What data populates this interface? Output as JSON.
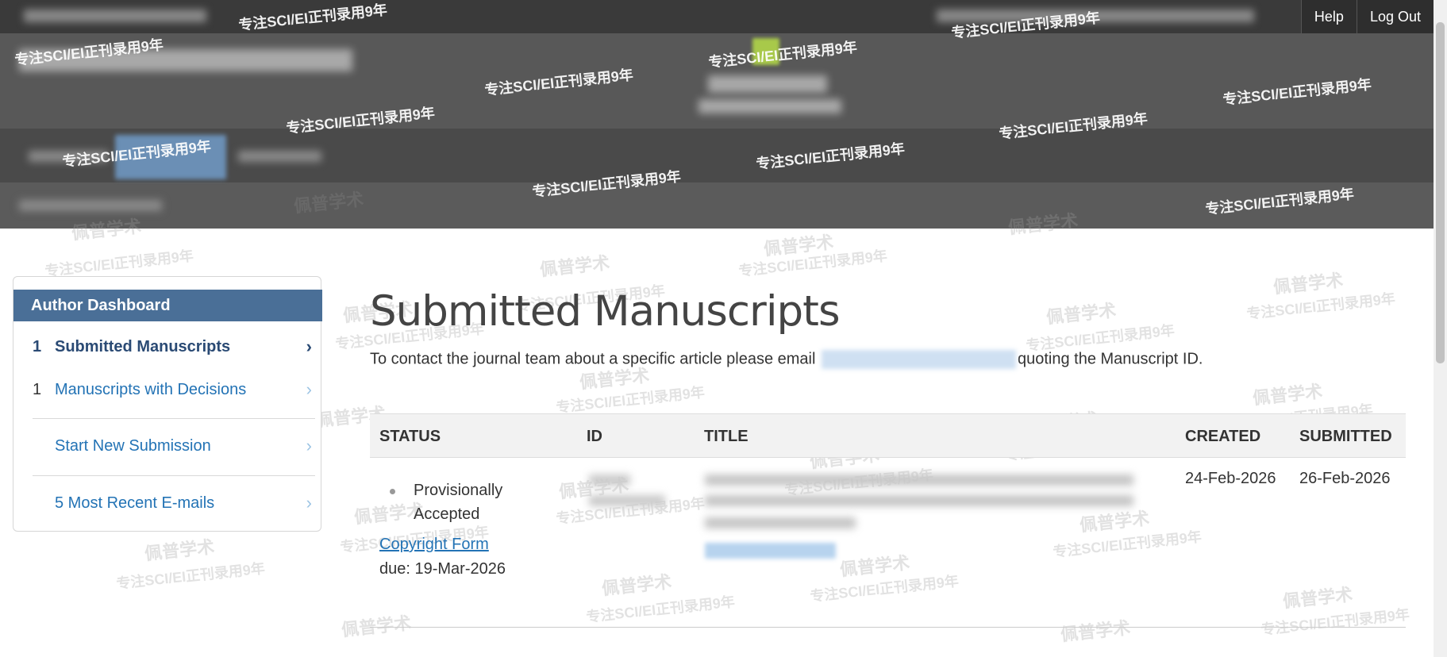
{
  "topnav": {
    "help": "Help",
    "logout": "Log Out"
  },
  "watermarks": {
    "slogan": "专注SCI/EI正刊录用9年",
    "brand": "佩普学术"
  },
  "sidebar": {
    "title": "Author Dashboard",
    "items": [
      {
        "count": "1",
        "label": "Submitted Manuscripts",
        "chevron": "›"
      },
      {
        "count": "1",
        "label": "Manuscripts with Decisions",
        "chevron": "›"
      },
      {
        "count": "",
        "label": "Start New Submission",
        "chevron": "›"
      },
      {
        "count": "",
        "label": "5 Most Recent E-mails",
        "chevron": "›"
      }
    ]
  },
  "main": {
    "title": "Submitted Manuscripts",
    "intro_before": "To contact the journal team about a specific article please email",
    "intro_after": "quoting the Manuscript ID.",
    "table": {
      "headers": [
        "STATUS",
        "ID",
        "TITLE",
        "CREATED",
        "SUBMITTED"
      ],
      "rows": [
        {
          "status": "Provisionally Accepted",
          "link": "Copyright Form",
          "due": "due: 19-Mar-2026",
          "created": "24-Feb-2026",
          "submitted": "26-Feb-2026"
        }
      ]
    }
  },
  "icons": {
    "chevron": "chevron-right-icon",
    "status": "status-dot-icon"
  }
}
